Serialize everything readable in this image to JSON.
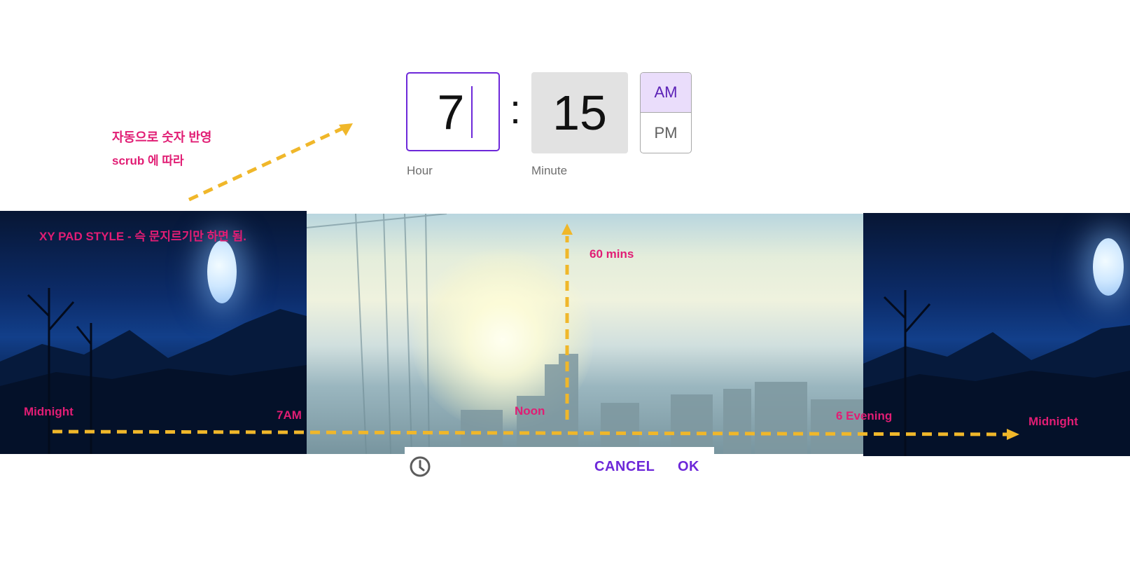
{
  "time_picker": {
    "hour_value": "7",
    "minute_value": "15",
    "separator": ":",
    "hour_label": "Hour",
    "minute_label": "Minute",
    "am_label": "AM",
    "pm_label": "PM",
    "selected_period": "AM"
  },
  "dialog_footer": {
    "clock_icon": "clock-icon",
    "cancel_label": "CANCEL",
    "ok_label": "OK"
  },
  "annotations": {
    "auto_reflect_line1": "자동으로 숫자 반영",
    "auto_reflect_line2": "scrub 에 따라",
    "xy_pad": "XY PAD STYLE - 슥 문지르기만 하면 됨.",
    "minutes_axis": "60 mins",
    "timeline": {
      "start": "Midnight",
      "seven": "7AM",
      "noon": "Noon",
      "evening": "6 Evening",
      "end": "Midnight"
    }
  },
  "colors": {
    "accent": "#6d28d9",
    "am_selected_bg": "#eaddfb",
    "annotation_text": "#e11d74",
    "arrow": "#f0b72a",
    "minute_box_bg": "#e2e2e2"
  }
}
